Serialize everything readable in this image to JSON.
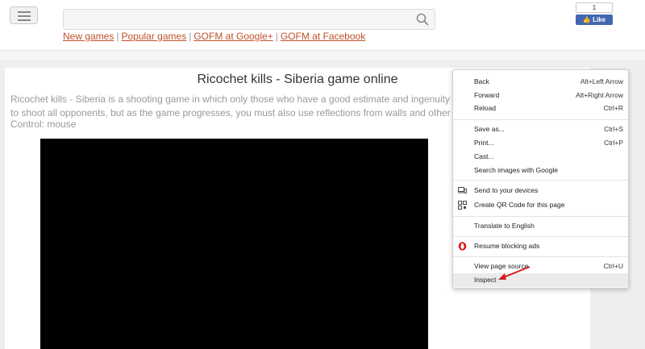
{
  "header": {
    "menu_icon": "hamburger-icon",
    "search_icon": "search-icon",
    "search": {
      "value": "",
      "placeholder": ""
    },
    "links": [
      "New games",
      "Popular games",
      "GOFM at Google+",
      "GOFM at Facebook"
    ],
    "link_separator": "|",
    "facebook": {
      "count": "1",
      "like_label": "Like",
      "icon": "thumbs-up-icon"
    }
  },
  "page": {
    "title": "Ricochet kills - Siberia game online",
    "description_line1": "Ricochet kills - Siberia is a shooting game in which only those who have a good estimate and ingenuity will",
    "description_line2": "to shoot all opponents, but as the game progresses, you must also use reflections from walls and other fi",
    "control": "Control: mouse"
  },
  "context_menu": {
    "items": [
      {
        "label": "Back",
        "shortcut": "Alt+Left Arrow"
      },
      {
        "label": "Forward",
        "shortcut": "Alt+Right Arrow"
      },
      {
        "label": "Reload",
        "shortcut": "Ctrl+R"
      },
      {
        "label": "Save as...",
        "shortcut": "Ctrl+S"
      },
      {
        "label": "Print...",
        "shortcut": "Ctrl+P"
      },
      {
        "label": "Cast...",
        "shortcut": ""
      },
      {
        "label": "Search images with Google",
        "shortcut": ""
      },
      {
        "label": "Send to your devices",
        "shortcut": "",
        "icon": "devices-icon"
      },
      {
        "label": "Create QR Code for this page",
        "shortcut": "",
        "icon": "qr-code-icon"
      },
      {
        "label": "Translate to English",
        "shortcut": ""
      },
      {
        "label": "Resume blocking ads",
        "shortcut": "",
        "icon": "opera-icon"
      },
      {
        "label": "View page source",
        "shortcut": "Ctrl+U"
      },
      {
        "label": "Inspect",
        "shortcut": ""
      }
    ],
    "highlighted": "Inspect"
  },
  "colors": {
    "link": "#c0502a",
    "accent_arrow": "#d41f1f",
    "facebook": "#4267b2",
    "game_canvas": "#000000"
  }
}
